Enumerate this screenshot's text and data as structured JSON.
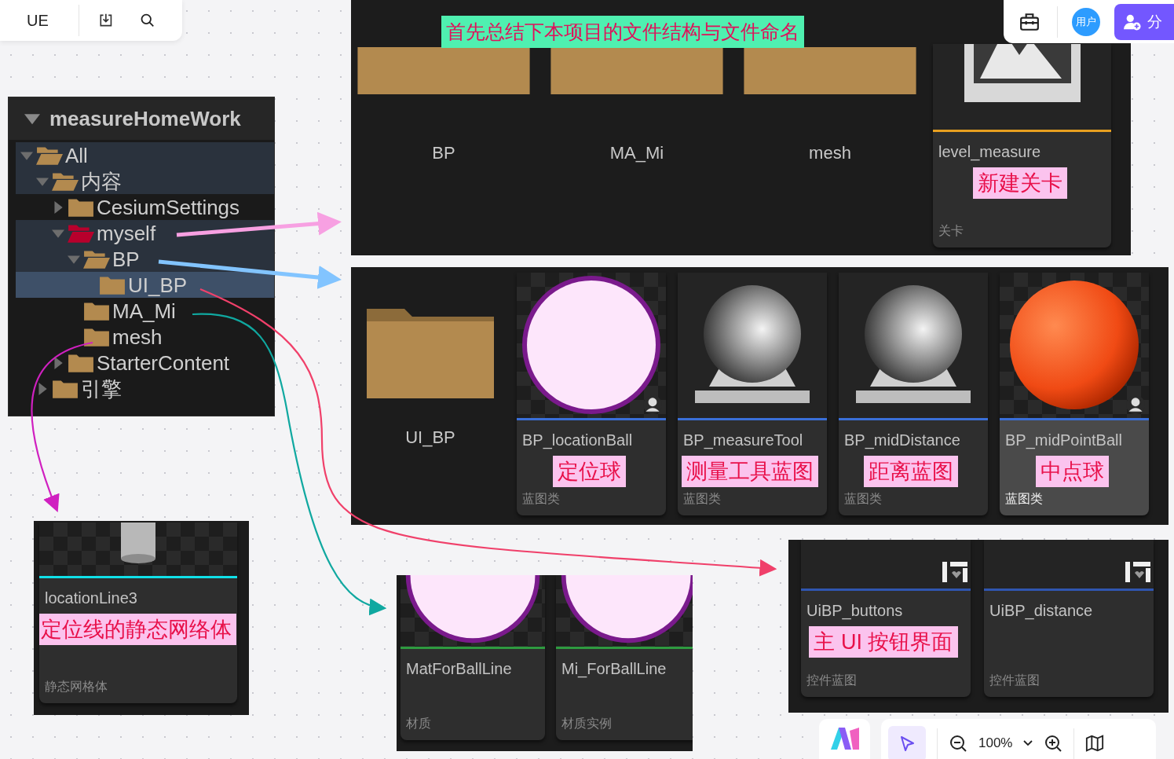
{
  "canvas_toolbar": {
    "title": "UE"
  },
  "header": {
    "avatar": "用户",
    "share_label": "分"
  },
  "heading_note": "首先总结下本项目的文件结构与文件命名",
  "tree": {
    "title": "measureHomeWork",
    "expanded": true,
    "items": [
      {
        "label": "All",
        "expanded": true,
        "selected": false,
        "color": "#b38a4f",
        "children": [
          {
            "label": "内容",
            "expanded": true,
            "selected": false,
            "color": "#b38a4f",
            "children": [
              {
                "label": "CesiumSettings",
                "expanded": false,
                "selected": false,
                "color": "#b38a4f"
              },
              {
                "label": "myself",
                "expanded": true,
                "selected": false,
                "color": "#b8002c",
                "children": [
                  {
                    "label": "BP",
                    "expanded": true,
                    "selected": false,
                    "color": "#b38a4f",
                    "children": [
                      {
                        "label": "UI_BP",
                        "selected": true,
                        "color": "#b38a4f"
                      }
                    ]
                  },
                  {
                    "label": "MA_Mi",
                    "selected": false,
                    "color": "#b38a4f"
                  },
                  {
                    "label": "mesh",
                    "selected": false,
                    "color": "#b38a4f"
                  }
                ]
              },
              {
                "label": "StarterContent",
                "expanded": false,
                "selected": false,
                "color": "#b38a4f"
              }
            ]
          },
          {
            "label": "引擎",
            "expanded": false,
            "selected": false,
            "color": "#b38a4f"
          }
        ]
      }
    ]
  },
  "panels": [
    {
      "assets": [
        {
          "kind": "folder",
          "name": "BP"
        },
        {
          "kind": "folder",
          "name": "MA_Mi"
        },
        {
          "kind": "folder",
          "name": "mesh"
        },
        {
          "kind": "level",
          "name": "level_measure",
          "note": "新建关卡",
          "type": "关卡",
          "color": "#e8a020",
          "selected": false,
          "badge": false
        }
      ]
    },
    {
      "assets": [
        {
          "kind": "folder",
          "name": "UI_BP"
        },
        {
          "kind": "glow_ball",
          "name": "BP_locationBall",
          "note": "定位球",
          "type": "蓝图类",
          "color": "#3a6fd8",
          "selected": false,
          "badge": true
        },
        {
          "kind": "grey_ball",
          "name": "BP_measureTool",
          "note": "测量工具蓝图",
          "type": "蓝图类",
          "color": "#3a6fd8",
          "selected": false,
          "badge": false
        },
        {
          "kind": "grey_ball",
          "name": "BP_midDistance",
          "note": "距离蓝图",
          "type": "蓝图类",
          "color": "#3a6fd8",
          "selected": false,
          "badge": false
        },
        {
          "kind": "orange_ball",
          "name": "BP_midPointBall",
          "note": "中点球",
          "type": "蓝图类",
          "color": "#3a6fd8",
          "selected": true,
          "badge": true
        }
      ]
    },
    {
      "assets": [
        {
          "kind": "mesh",
          "name": "locationLine3",
          "note": "定位线的静态网络体",
          "type": "静态网格体",
          "color": "#10e0e8",
          "selected": false,
          "badge": false
        }
      ]
    },
    {
      "assets": [
        {
          "kind": "widget",
          "name": "UiBP_buttons",
          "note": "主 UI 按钮界面",
          "type": "控件蓝图",
          "color": "#2f55b0",
          "selected": false,
          "badge": false
        },
        {
          "kind": "widget",
          "name": "UiBP_distance",
          "type": "控件蓝图",
          "color": "#2f55b0",
          "selected": false,
          "badge": false
        }
      ]
    },
    {
      "assets": [
        {
          "kind": "glow_ball",
          "name": "MatForBallLine",
          "type": "材质",
          "color": "#2e9a40",
          "selected": false,
          "badge": false
        },
        {
          "kind": "glow_ball",
          "name": "Mi_ForBallLine",
          "type": "材质实例",
          "color": "#2e9a40",
          "selected": false,
          "badge": false
        }
      ]
    }
  ],
  "bottom_toolbar": {
    "pointer_selected": true,
    "zoom": "100%"
  }
}
